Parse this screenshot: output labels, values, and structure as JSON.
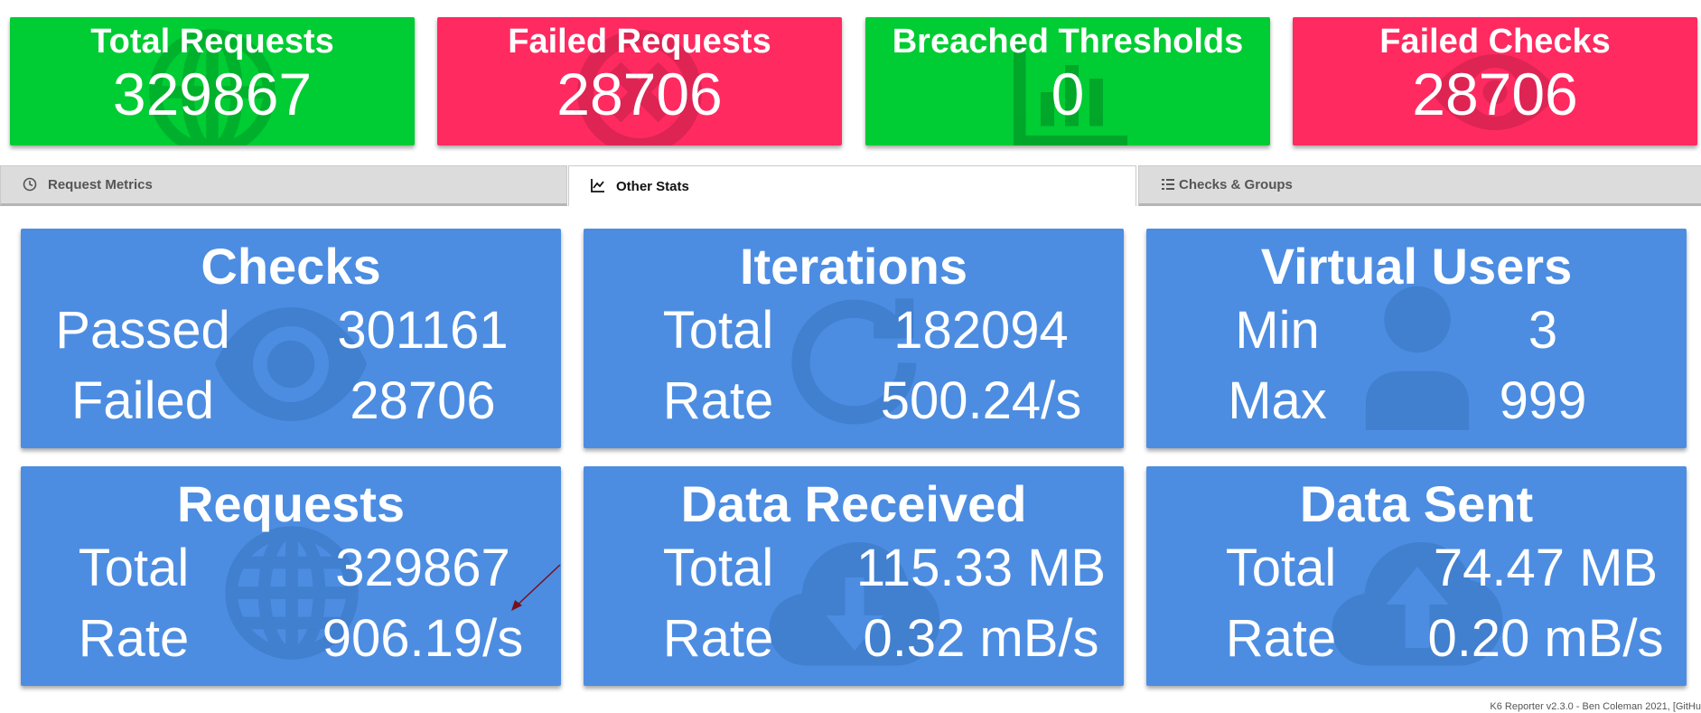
{
  "summary": {
    "total_requests": {
      "title": "Total Requests",
      "value": "329867",
      "icon": "globe-icon",
      "color": "#00cc33"
    },
    "failed_requests": {
      "title": "Failed Requests",
      "value": "28706",
      "icon": "times-circle-icon",
      "color": "#ff2a60"
    },
    "breached_thresholds": {
      "title": "Breached Thresholds",
      "value": "0",
      "icon": "chart-bar-icon",
      "color": "#00cc33"
    },
    "failed_checks": {
      "title": "Failed Checks",
      "value": "28706",
      "icon": "eye-icon",
      "color": "#ff2a60"
    }
  },
  "tabs": [
    {
      "label": "Request Metrics",
      "icon": "clock-icon",
      "active": false
    },
    {
      "label": "Other Stats",
      "icon": "chart-line-icon",
      "active": true
    },
    {
      "label": "Checks & Groups",
      "icon": "tasks-icon",
      "active": false
    }
  ],
  "stats": {
    "checks": {
      "title": "Checks",
      "row1_label": "Passed",
      "row1_value": "301161",
      "row2_label": "Failed",
      "row2_value": "28706",
      "icon": "eye-icon"
    },
    "iterations": {
      "title": "Iterations",
      "row1_label": "Total",
      "row1_value": "182094",
      "row2_label": "Rate",
      "row2_value": "500.24/s",
      "icon": "redo-icon"
    },
    "virtual_users": {
      "title": "Virtual Users",
      "row1_label": "Min",
      "row1_value": "3",
      "row2_label": "Max",
      "row2_value": "999",
      "icon": "user-icon"
    },
    "requests": {
      "title": "Requests",
      "row1_label": "Total",
      "row1_value": "329867",
      "row2_label": "Rate",
      "row2_value": "906.19/s",
      "icon": "globe-icon"
    },
    "data_received": {
      "title": "Data Received",
      "row1_label": "Total",
      "row1_value": "115.33 MB",
      "row2_label": "Rate",
      "row2_value": "0.32 mB/s",
      "icon": "cloud-download-icon"
    },
    "data_sent": {
      "title": "Data Sent",
      "row1_label": "Total",
      "row1_value": "74.47 MB",
      "row2_label": "Rate",
      "row2_value": "0.20 mB/s",
      "icon": "cloud-upload-icon"
    }
  },
  "colors": {
    "stat_bg": "#4c8de2",
    "green": "#00cc33",
    "red": "#ff2a60",
    "icon_dark": "#1c4f8f"
  },
  "footer": {
    "text": "K6 Reporter v2.3.0 - Ben Coleman 2021, [GitHu"
  }
}
